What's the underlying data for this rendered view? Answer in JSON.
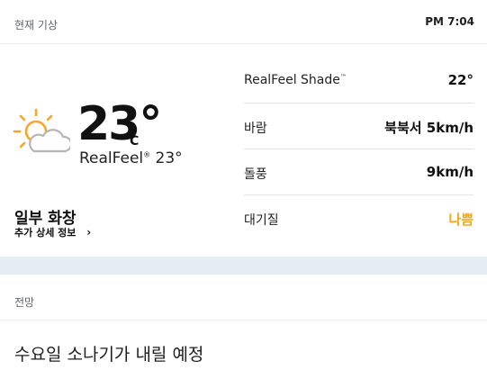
{
  "header": {
    "title": "현재 기상",
    "time": "PM 7:04"
  },
  "current": {
    "icon": "partly-sunny-icon",
    "temperature": "23°",
    "unit": "C",
    "realfeel_label": "RealFeel",
    "realfeel_mark": "®",
    "realfeel_value": "23°",
    "condition": "일부 화창",
    "more_details": "추가 상세 정보"
  },
  "details": [
    {
      "label": "RealFeel Shade",
      "mark": "™",
      "value": "22°",
      "status": "normal"
    },
    {
      "label": "바람",
      "mark": "",
      "value": "북북서 5km/h",
      "status": "normal"
    },
    {
      "label": "돌풍",
      "mark": "",
      "value": "9km/h",
      "status": "normal"
    },
    {
      "label": "대기질",
      "mark": "",
      "value": "나쁨",
      "status": "bad"
    }
  ],
  "forecast": {
    "title": "전망",
    "text": "수요일 소나기가 내릴 예정"
  },
  "colors": {
    "accent_bad": "#f0a81e",
    "divider_band": "#e5ecf4"
  }
}
